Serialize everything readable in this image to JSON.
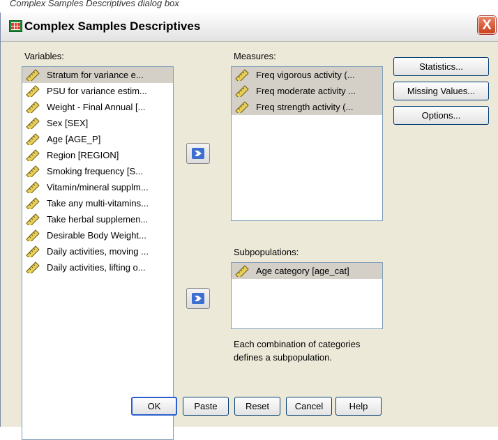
{
  "caption": "Complex Samples Descriptives dialog box",
  "window": {
    "title": "Complex Samples Descriptives",
    "close_label": "X"
  },
  "variables": {
    "label": "Variables:",
    "items": [
      "Stratum for variance e...",
      "PSU for variance estim...",
      "Weight - Final Annual [...",
      "Sex [SEX]",
      "Age [AGE_P]",
      "Region [REGION]",
      "Smoking frequency [S...",
      "Vitamin/mineral supplm...",
      "Take any multi-vitamins...",
      "Take herbal supplemen...",
      "Desirable Body Weight...",
      "Daily activities, moving ...",
      "Daily activities, lifting o..."
    ],
    "selected_index": 0
  },
  "measures": {
    "label": "Measures:",
    "items": [
      "Freq vigorous activity (...",
      "Freq moderate activity ...",
      "Freq strength activity (..."
    ]
  },
  "subpopulations": {
    "label": "Subpopulations:",
    "items": [
      "Age category [age_cat]"
    ]
  },
  "note": "Each combination of categories defines a subpopulation.",
  "side_buttons": {
    "statistics": "Statistics...",
    "missing_values": "Missing Values...",
    "options": "Options..."
  },
  "bottom_buttons": {
    "ok": "OK",
    "paste": "Paste",
    "reset": "Reset",
    "cancel": "Cancel",
    "help": "Help"
  }
}
